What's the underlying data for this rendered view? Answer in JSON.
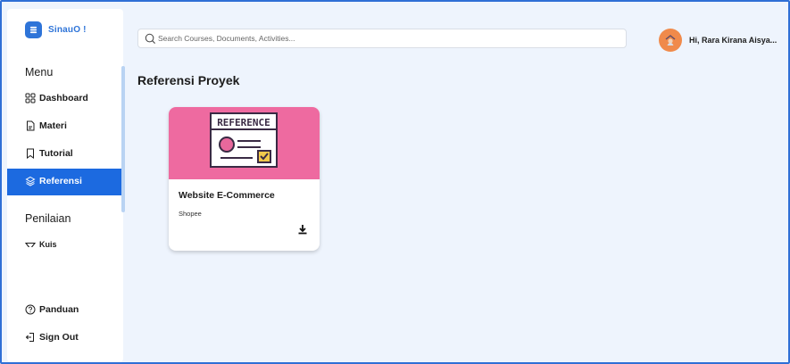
{
  "app": {
    "logo_text": "SinauO !"
  },
  "sidebar": {
    "menu_title": "Menu",
    "items": [
      {
        "label": "Dashboard",
        "icon": "grid-icon"
      },
      {
        "label": "Materi",
        "icon": "document-icon"
      },
      {
        "label": "Tutorial",
        "icon": "bookmark-icon"
      },
      {
        "label": "Referensi",
        "icon": "layers-icon",
        "active": true
      }
    ],
    "assessment_title": "Penilaian",
    "assessment_items": [
      {
        "label": "Kuis",
        "icon": "quiz-icon"
      }
    ],
    "footer_items": [
      {
        "label": "Panduan",
        "icon": "help-circle-icon"
      },
      {
        "label": "Sign Out",
        "icon": "sign-out-icon"
      }
    ]
  },
  "header": {
    "search_placeholder": "Search Courses, Documents, Activities...",
    "user_greeting": "Hi, Rara Kirana Aisya..."
  },
  "main": {
    "title": "Referensi Proyek",
    "cards": [
      {
        "banner_text": "REFERENCE",
        "title": "Website E-Commerce",
        "subtitle": "Shopee"
      }
    ]
  },
  "colors": {
    "primary": "#1c6ae0",
    "card_banner": "#ee6aa0",
    "background": "#eef4fd",
    "avatar": "#f08a4b"
  }
}
